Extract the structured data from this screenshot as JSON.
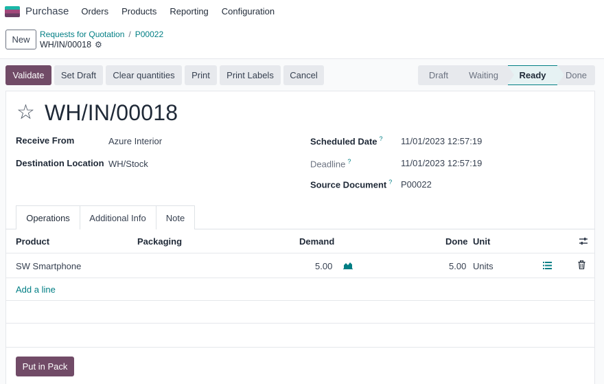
{
  "navbar": {
    "app_name": "Purchase",
    "menu": [
      "Orders",
      "Products",
      "Reporting",
      "Configuration"
    ]
  },
  "control_panel": {
    "new_label": "New",
    "breadcrumb": [
      "Requests for Quotation",
      "P00022"
    ],
    "record_name": "WH/IN/00018"
  },
  "actions": {
    "validate": "Validate",
    "set_draft": "Set Draft",
    "clear_quantities": "Clear quantities",
    "print": "Print",
    "print_labels": "Print Labels",
    "cancel": "Cancel"
  },
  "statusbar": {
    "stages": [
      "Draft",
      "Waiting",
      "Ready",
      "Done"
    ],
    "current": "Ready"
  },
  "form": {
    "title": "WH/IN/00018",
    "receive_from_label": "Receive From",
    "receive_from": "Azure Interior",
    "destination_label": "Destination Location",
    "destination": "WH/Stock",
    "scheduled_date_label": "Scheduled Date",
    "scheduled_date": "11/01/2023 12:57:19",
    "deadline_label": "Deadline",
    "deadline": "11/01/2023 12:57:19",
    "source_document_label": "Source Document",
    "source_document": "P00022",
    "help_mark": "?"
  },
  "tabs": [
    "Operations",
    "Additional Info",
    "Note"
  ],
  "operations": {
    "columns": [
      "Product",
      "Packaging",
      "Demand",
      "Done",
      "Unit"
    ],
    "rows": [
      {
        "product": "SW Smartphone",
        "packaging": "",
        "demand": "5.00",
        "done": "5.00",
        "unit": "Units"
      }
    ],
    "add_line": "Add a line"
  },
  "put_in_pack": "Put in Pack",
  "colors": {
    "primary": "#714b67",
    "link": "#017e84"
  }
}
